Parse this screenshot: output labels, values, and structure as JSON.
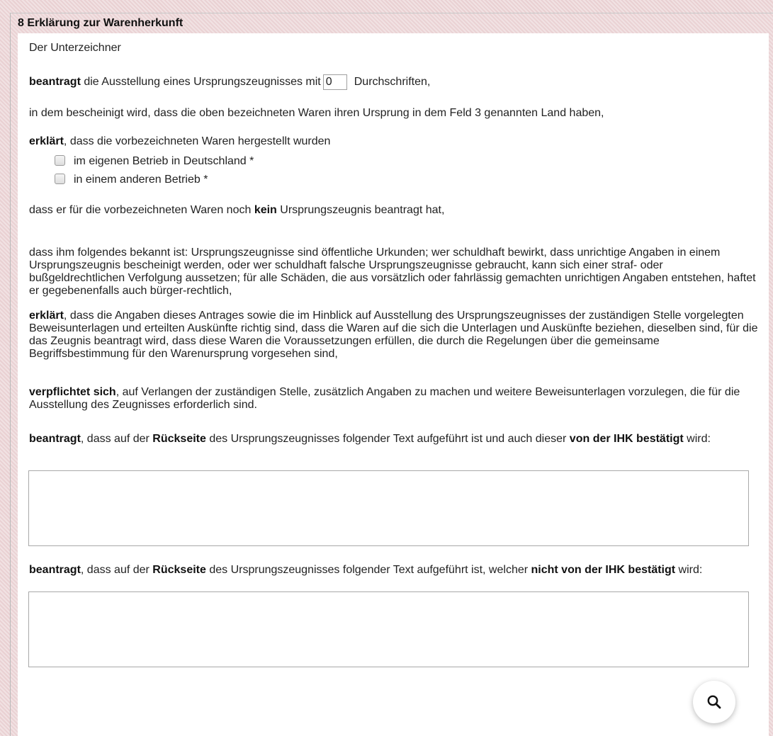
{
  "section": {
    "title": "8 Erklärung zur Warenherkunft"
  },
  "form": {
    "signer_label": "Der Unterzeichner",
    "apply": {
      "bold": "beantragt",
      "text_before": " die Ausstellung eines Ursprungszeugnisses mit",
      "copies_value": "0",
      "text_after": "Durchschriften,"
    },
    "certified_text": "in dem bescheinigt wird, dass die oben bezeichneten Waren ihren Ursprung in dem Feld 3 genannten Land haben,",
    "produced": {
      "bold": "erklärt",
      "text": ", dass die vorbezeichneten Waren hergestellt wurden"
    },
    "options": [
      {
        "label": "im eigenen Betrieb in Deutschland *",
        "checked": false
      },
      {
        "label": "in einem anderen Betrieb *",
        "checked": false
      }
    ],
    "not_applied": {
      "before": "dass er für die vorbezeichneten Waren noch ",
      "bold": "kein",
      "after": " Ursprungszeugnis beantragt hat,"
    },
    "known_text": "dass ihm folgendes bekannt ist: Ursprungszeugnisse sind öffentliche Urkunden; wer schuldhaft bewirkt, dass unrichtige Angaben in einem Ursprungszeugnis bescheinigt werden, oder wer schuldhaft falsche Ursprungszeugnisse gebraucht, kann sich einer straf- oder bußgeldrechtlichen Verfolgung aussetzen; für alle Schäden, die aus vorsätzlich oder fahrlässig gemachten unrichtigen Angaben entstehen, haftet er gegebenenfalls auch bürger-rechtlich,",
    "declares_correct": {
      "bold": "erklärt",
      "text": ", dass die Angaben dieses Antrages sowie die im Hinblick auf Ausstellung des Ursprungszeugnisses der zuständigen Stelle vorgelegten Beweisunterlagen und erteilten Auskünfte richtig sind, dass die Waren auf die sich die Unterlagen und Auskünfte beziehen, dieselben sind, für die das Zeugnis beantragt wird, dass diese Waren die Voraussetzungen erfüllen, die durch die Regelungen über die gemeinsame Begriffsbestimmung für den Warenursprung vorgesehen sind,"
    },
    "obliges": {
      "bold": "verpflichtet sich",
      "text": ", auf Verlangen der zuständigen Stelle, zusätzlich Angaben zu machen und weitere Beweisunterlagen vorzulegen, die für die Ausstellung des Zeugnisses erforderlich sind."
    },
    "reverse_confirmed": {
      "b1": "beantragt",
      "t1": ", dass auf der ",
      "b2": "Rückseite",
      "t2": " des Ursprungszeugnisses folgender Text aufgeführt ist und auch dieser ",
      "b3": "von der IHK bestätigt",
      "t3": " wird:",
      "value": ""
    },
    "reverse_unconfirmed": {
      "b1": "beantragt",
      "t1": ", dass auf der ",
      "b2": "Rückseite",
      "t2": " des Ursprungszeugnisses folgender Text aufgeführt ist, welcher ",
      "b3": "nicht von der IHK bestätigt",
      "t3": " wird:",
      "value": ""
    }
  },
  "fab": {
    "icon": "search-icon"
  }
}
